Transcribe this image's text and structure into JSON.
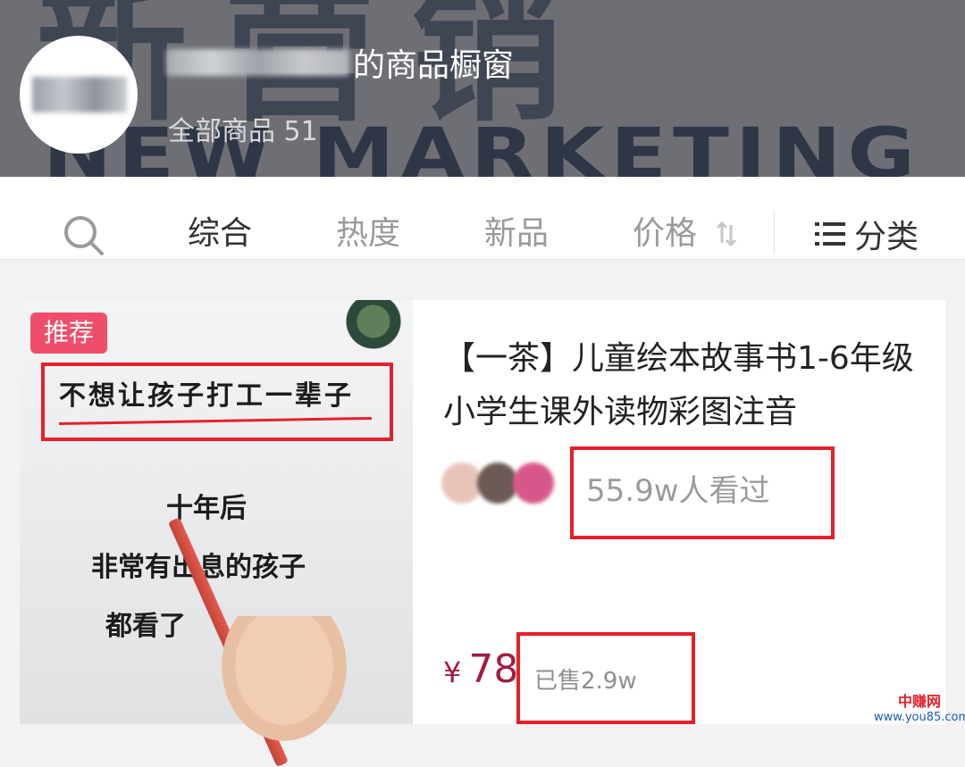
{
  "header": {
    "banner_text": "新营销",
    "banner_word": "NEW MARKETING",
    "shop_title_suffix": "的商品橱窗",
    "all_goods": "全部商品 51"
  },
  "filter_bar": {
    "tabs": [
      {
        "label": "综合",
        "active": true
      },
      {
        "label": "热度",
        "active": false
      },
      {
        "label": "新品",
        "active": false
      },
      {
        "label": "价格",
        "active": false
      }
    ],
    "category_label": "分类",
    "search_icon": "search-icon",
    "sort_icon": "sort-arrows-icon",
    "category_icon": "list-icon"
  },
  "product": {
    "badge": "推荐",
    "thumbnail_lines": [
      "不想让孩子打工一辈子",
      "十年后",
      "非常有出息的孩子",
      "都看了"
    ],
    "title": "【一茶】儿童绘本故事书1-6年级小学生课外读物彩图注音",
    "views": "55.9w人看过",
    "currency": "¥",
    "price": "78",
    "sold": "已售2.9w"
  },
  "watermark": {
    "line1": "中赚网",
    "line2": "www.you85.com"
  },
  "colors": {
    "accent_red": "#e5202b",
    "price": "#a11d3f",
    "badge": "#ef4e6a"
  }
}
